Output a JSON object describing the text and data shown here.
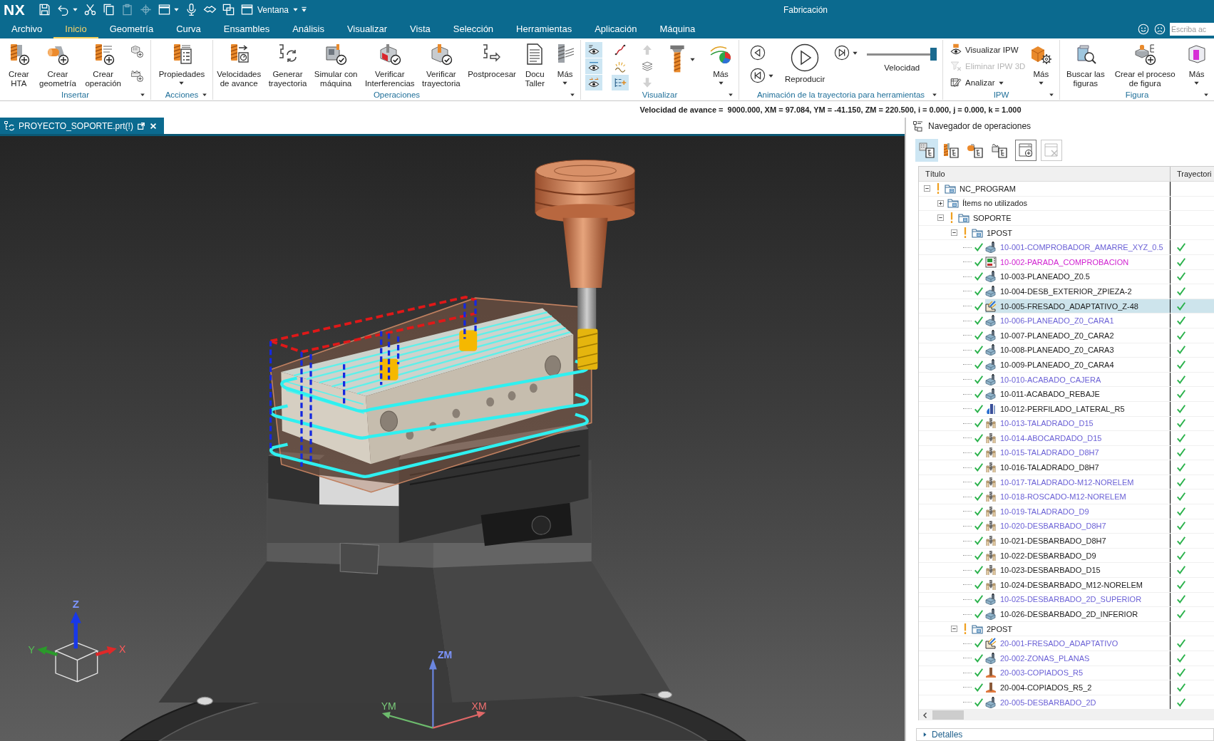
{
  "app": {
    "logo": "NX",
    "title": "Fabricación",
    "window_menu": "Ventana"
  },
  "quick_access": [
    {
      "disabled": false,
      "dropdown": false
    },
    {
      "disabled": false,
      "dropdown": true
    },
    {
      "disabled": false,
      "dropdown": false
    },
    {
      "disabled": false,
      "dropdown": false
    },
    {
      "disabled": true,
      "dropdown": false
    },
    {
      "disabled": true,
      "dropdown": false
    },
    {
      "disabled": false,
      "dropdown": true
    },
    {
      "disabled": false,
      "dropdown": false
    },
    {
      "disabled": false,
      "dropdown": false
    },
    {
      "disabled": false,
      "dropdown": false
    }
  ],
  "tabs": [
    {
      "label": "Archivo",
      "selected": false
    },
    {
      "label": "Inicio",
      "selected": true
    },
    {
      "label": "Geometría",
      "selected": false
    },
    {
      "label": "Curva",
      "selected": false
    },
    {
      "label": "Ensambles",
      "selected": false
    },
    {
      "label": "Análisis",
      "selected": false
    },
    {
      "label": "Visualizar",
      "selected": false
    },
    {
      "label": "Vista",
      "selected": false
    },
    {
      "label": "Selección",
      "selected": false
    },
    {
      "label": "Herramientas",
      "selected": false
    },
    {
      "label": "Aplicación",
      "selected": false
    },
    {
      "label": "Máquina",
      "selected": false
    }
  ],
  "search": {
    "placeholder": "Escriba ac"
  },
  "ribbon": {
    "groups": [
      {
        "label": "Insertar",
        "kind": "buttons",
        "buttons": [
          {
            "kind": "large",
            "label": "Crear\nHTA",
            "dropdown": false
          },
          {
            "kind": "large",
            "label": "Crear\ngeometría",
            "dropdown": false
          },
          {
            "kind": "large",
            "label": "Crear\noperación",
            "dropdown": false
          },
          {
            "kind": "stack",
            "items": [
              {
                "on": false,
                "disabled": false,
                "dropdown": false
              },
              {
                "on": false,
                "disabled": false,
                "dropdown": false
              }
            ]
          }
        ]
      },
      {
        "label": "Acciones",
        "kind": "buttons",
        "buttons": [
          {
            "kind": "large",
            "label": "Propiedades",
            "dropdown": true
          }
        ]
      },
      {
        "label": "Operaciones",
        "kind": "buttons",
        "buttons": [
          {
            "kind": "large",
            "label": "Velocidades\nde avance",
            "dropdown": false
          },
          {
            "kind": "large",
            "label": "Generar\ntrayectoria",
            "dropdown": false
          },
          {
            "kind": "large",
            "label": "Simular con\nmáquina",
            "dropdown": false
          },
          {
            "kind": "large",
            "label": "Verificar\nInterferencias",
            "dropdown": false
          },
          {
            "kind": "large",
            "label": "Verificar\ntrayectoria",
            "dropdown": false
          },
          {
            "kind": "large",
            "label": "Postprocesar",
            "dropdown": false
          },
          {
            "kind": "large",
            "label": "Docu\nTaller",
            "dropdown": false
          },
          {
            "kind": "large",
            "label": "Más",
            "dropdown": true
          }
        ]
      },
      {
        "label": "Visualizar",
        "kind": "buttons",
        "buttons": [
          {
            "kind": "stack",
            "items": [
              {
                "on": true,
                "disabled": false,
                "dropdown": false
              },
              {
                "on": true,
                "disabled": false,
                "dropdown": false
              },
              {
                "on": true,
                "disabled": false,
                "dropdown": false
              }
            ]
          },
          {
            "kind": "stack",
            "items": [
              {
                "on": false,
                "disabled": false,
                "dropdown": false
              },
              {
                "on": false,
                "disabled": false,
                "dropdown": false
              },
              {
                "on": true,
                "disabled": false,
                "dropdown": false
              }
            ]
          },
          {
            "kind": "stack",
            "items": [
              {
                "on": false,
                "disabled": true,
                "dropdown": false
              },
              {
                "on": false,
                "disabled": false,
                "dropdown": false
              },
              {
                "on": false,
                "disabled": true,
                "dropdown": false
              }
            ]
          },
          {
            "kind": "large",
            "dropdown": true
          },
          {
            "kind": "large",
            "label": "Más",
            "dropdown": true
          }
        ]
      },
      {
        "label": "Animación de la trayectoria para herramientas",
        "kind": "player",
        "play_label": "Reproducir",
        "speed": {
          "label": "Velocidad",
          "level": 1
        }
      },
      {
        "label": "IPW",
        "kind": "buttons",
        "buttons": [
          {
            "kind": "stack",
            "items": [
              {
                "label": "Visualizar IPW",
                "on": false,
                "disabled": false,
                "dropdown": false
              },
              {
                "label": "Eliminar IPW 3D",
                "on": false,
                "disabled": true,
                "dropdown": false
              },
              {
                "label": "Analizar",
                "on": false,
                "disabled": false,
                "dropdown": true
              }
            ]
          },
          {
            "kind": "large",
            "label": "Más",
            "dropdown": true
          }
        ]
      },
      {
        "label": "Figura",
        "kind": "buttons",
        "buttons": [
          {
            "kind": "large",
            "label": "Buscar las\nfiguras",
            "dropdown": false
          },
          {
            "kind": "large",
            "label": "Crear el proceso\nde figura",
            "dropdown": false
          },
          {
            "kind": "large",
            "label": "Más",
            "dropdown": true
          }
        ]
      }
    ]
  },
  "status_line": "Velocidad de avance =  9000.000, XM = 97.084, YM = -41.150, ZM = 220.500, i = 0.000, j = 0.000, k = 1.000",
  "document_tab": {
    "label": "PROYECTO_SOPORTE.prt(!)",
    "selected": true
  },
  "viewport": {
    "view_triad": {
      "x": "X",
      "y": "Y",
      "z": "Z"
    },
    "wcs": {
      "x": "XM",
      "y": "YM",
      "z": "ZM"
    }
  },
  "navigator": {
    "title": "Navegador de operaciones",
    "views": [
      {
        "selected": true
      },
      {
        "selected": false
      },
      {
        "selected": false
      },
      {
        "selected": false
      }
    ],
    "actions": [
      {
        "disabled": false
      },
      {
        "disabled": true
      }
    ],
    "columns": [
      "Título",
      "Trayectori"
    ],
    "tree": [
      {
        "name": "NC_PROGRAM",
        "kind": "group",
        "color": "#1b1b1b",
        "warning": true,
        "expanded": true,
        "selected": false,
        "children": [
          {
            "name": "Ítems no utilizados",
            "kind": "group",
            "color": "#1b1b1b",
            "warning": false,
            "expanded": false,
            "selected": false
          },
          {
            "name": "SOPORTE",
            "kind": "group",
            "color": "#1b1b1b",
            "warning": true,
            "expanded": true,
            "selected": false,
            "children": [
              {
                "name": "1POST",
                "kind": "group",
                "color": "#1b1b1b",
                "warning": true,
                "expanded": true,
                "selected": false,
                "children": [
                  {
                    "name": "10-001-COMPROBADOR_AMARRE_XYZ_0.5",
                    "kind": "mill",
                    "color": "#6b61d6",
                    "complete": true,
                    "toolpath": true,
                    "selected": false
                  },
                  {
                    "name": "10-002-PARADA_COMPROBACION",
                    "kind": "stop",
                    "color": "#d01fd0",
                    "complete": true,
                    "toolpath": true,
                    "selected": false
                  },
                  {
                    "name": "10-003-PLANEADO_Z0.5",
                    "kind": "mill",
                    "color": "#1b1b1b",
                    "complete": true,
                    "toolpath": true,
                    "selected": false
                  },
                  {
                    "name": "10-004-DESB_EXTERIOR_ZPIEZA-2",
                    "kind": "mill",
                    "color": "#1b1b1b",
                    "complete": true,
                    "toolpath": true,
                    "selected": false
                  },
                  {
                    "name": "10-005-FRESADO_ADAPTATIVO_Z-48",
                    "kind": "adaptive",
                    "color": "#1b1b1b",
                    "complete": true,
                    "toolpath": true,
                    "selected": true
                  },
                  {
                    "name": "10-006-PLANEADO_Z0_CARA1",
                    "kind": "mill",
                    "color": "#6b61d6",
                    "complete": true,
                    "toolpath": true,
                    "selected": false
                  },
                  {
                    "name": "10-007-PLANEADO_Z0_CARA2",
                    "kind": "mill",
                    "color": "#1b1b1b",
                    "complete": true,
                    "toolpath": true,
                    "selected": false
                  },
                  {
                    "name": "10-008-PLANEADO_Z0_CARA3",
                    "kind": "mill",
                    "color": "#1b1b1b",
                    "complete": true,
                    "toolpath": true,
                    "selected": false
                  },
                  {
                    "name": "10-009-PLANEADO_Z0_CARA4",
                    "kind": "mill",
                    "color": "#1b1b1b",
                    "complete": true,
                    "toolpath": true,
                    "selected": false
                  },
                  {
                    "name": "10-010-ACABADO_CAJERA",
                    "kind": "mill",
                    "color": "#6b61d6",
                    "complete": true,
                    "toolpath": true,
                    "selected": false
                  },
                  {
                    "name": "10-011-ACABADO_REBAJE",
                    "kind": "mill",
                    "color": "#1b1b1b",
                    "complete": true,
                    "toolpath": true,
                    "selected": false
                  },
                  {
                    "name": "10-012-PERFILADO_LATERAL_R5",
                    "kind": "profile",
                    "color": "#1b1b1b",
                    "complete": true,
                    "toolpath": true,
                    "selected": false
                  },
                  {
                    "name": "10-013-TALADRADO_D15",
                    "kind": "drill",
                    "color": "#6b61d6",
                    "complete": true,
                    "toolpath": true,
                    "selected": false
                  },
                  {
                    "name": "10-014-ABOCARDADO_D15",
                    "kind": "drill",
                    "color": "#6b61d6",
                    "complete": true,
                    "toolpath": true,
                    "selected": false
                  },
                  {
                    "name": "10-015-TALADRADO_D8H7",
                    "kind": "drill",
                    "color": "#6b61d6",
                    "complete": true,
                    "toolpath": true,
                    "selected": false
                  },
                  {
                    "name": "10-016-TALADRADO_D8H7",
                    "kind": "drill",
                    "color": "#1b1b1b",
                    "complete": true,
                    "toolpath": true,
                    "selected": false
                  },
                  {
                    "name": "10-017-TALADRADO-M12-NORELEM",
                    "kind": "drill",
                    "color": "#6b61d6",
                    "complete": true,
                    "toolpath": true,
                    "selected": false
                  },
                  {
                    "name": "10-018-ROSCADO-M12-NORELEM",
                    "kind": "drill",
                    "color": "#6b61d6",
                    "complete": true,
                    "toolpath": true,
                    "selected": false
                  },
                  {
                    "name": "10-019-TALADRADO_D9",
                    "kind": "drill",
                    "color": "#6b61d6",
                    "complete": true,
                    "toolpath": true,
                    "selected": false
                  },
                  {
                    "name": "10-020-DESBARBADO_D8H7",
                    "kind": "drill",
                    "color": "#6b61d6",
                    "complete": true,
                    "toolpath": true,
                    "selected": false
                  },
                  {
                    "name": "10-021-DESBARBADO_D8H7",
                    "kind": "drill",
                    "color": "#1b1b1b",
                    "complete": true,
                    "toolpath": true,
                    "selected": false
                  },
                  {
                    "name": "10-022-DESBARBADO_D9",
                    "kind": "drill",
                    "color": "#1b1b1b",
                    "complete": true,
                    "toolpath": true,
                    "selected": false
                  },
                  {
                    "name": "10-023-DESBARBADO_D15",
                    "kind": "drill",
                    "color": "#1b1b1b",
                    "complete": true,
                    "toolpath": true,
                    "selected": false
                  },
                  {
                    "name": "10-024-DESBARBADO_M12-NORELEM",
                    "kind": "drill",
                    "color": "#1b1b1b",
                    "complete": true,
                    "toolpath": true,
                    "selected": false
                  },
                  {
                    "name": "10-025-DESBARBADO_2D_SUPERIOR",
                    "kind": "mill",
                    "color": "#6b61d6",
                    "complete": true,
                    "toolpath": true,
                    "selected": false
                  },
                  {
                    "name": "10-026-DESBARBADO_2D_INFERIOR",
                    "kind": "mill",
                    "color": "#1b1b1b",
                    "complete": true,
                    "toolpath": true,
                    "selected": false
                  }
                ]
              },
              {
                "name": "2POST",
                "kind": "group",
                "color": "#1b1b1b",
                "warning": true,
                "expanded": true,
                "selected": false,
                "children": [
                  {
                    "name": "20-001-FRESADO_ADAPTATIVO",
                    "kind": "adaptive",
                    "color": "#6b61d6",
                    "complete": true,
                    "toolpath": true,
                    "selected": false
                  },
                  {
                    "name": "20-002-ZONAS_PLANAS",
                    "kind": "mill",
                    "color": "#6b61d6",
                    "complete": true,
                    "toolpath": true,
                    "selected": false
                  },
                  {
                    "name": "20-003-COPIADOS_R5",
                    "kind": "contour",
                    "color": "#6b61d6",
                    "complete": true,
                    "toolpath": true,
                    "selected": false
                  },
                  {
                    "name": "20-004-COPIADOS_R5_2",
                    "kind": "contour",
                    "color": "#1b1b1b",
                    "complete": true,
                    "toolpath": true,
                    "selected": false
                  },
                  {
                    "name": "20-005-DESBARBADO_2D",
                    "kind": "mill",
                    "color": "#6b61d6",
                    "complete": true,
                    "toolpath": true,
                    "selected": false
                  }
                ]
              }
            ]
          }
        ]
      }
    ],
    "details": "Detalles"
  }
}
